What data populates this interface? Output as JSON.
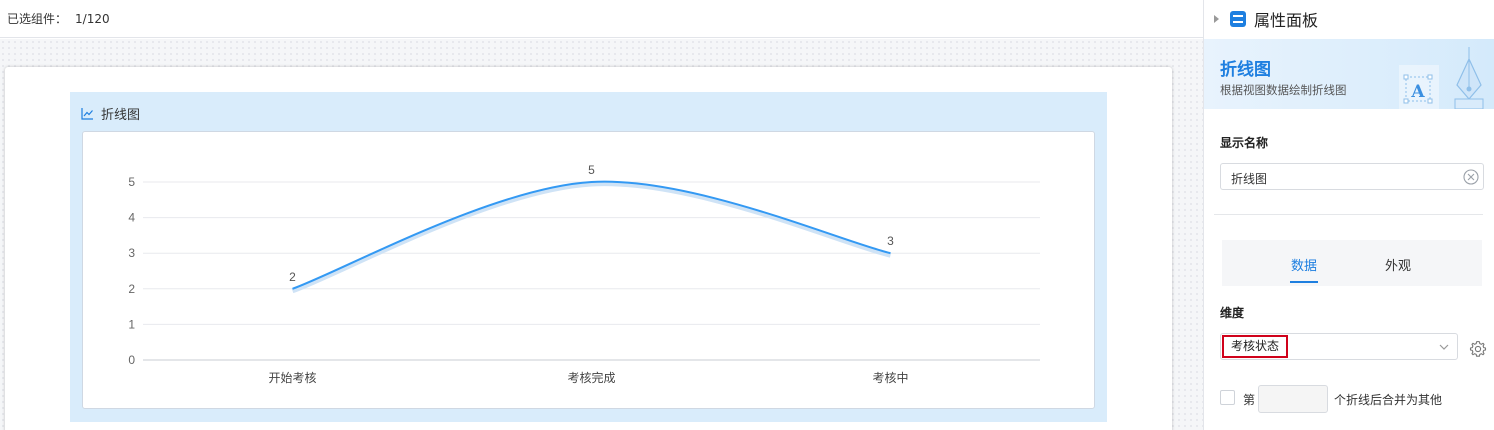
{
  "canvas": {
    "selected_label": "已选组件：",
    "selected_value": "1/120"
  },
  "widget": {
    "title": "折线图",
    "icon": "line-chart-icon"
  },
  "chart_data": {
    "type": "line",
    "categories": [
      "开始考核",
      "考核完成",
      "考核中"
    ],
    "values": [
      2,
      5,
      3
    ],
    "data_labels": [
      "2",
      "5",
      "3"
    ],
    "ylim": [
      0,
      5
    ],
    "y_ticks": [
      "0",
      "1",
      "2",
      "3",
      "4",
      "5"
    ],
    "smooth": true,
    "grid": true,
    "line_color": "#3399f3"
  },
  "panel": {
    "title": "属性面板",
    "banner_title": "折线图",
    "banner_desc": "根据视图数据绘制折线图",
    "display_name_label": "显示名称",
    "display_name_value": "折线图",
    "tabs": [
      {
        "label": "数据",
        "active": true
      },
      {
        "label": "外观",
        "active": false
      }
    ],
    "dimension_label": "维度",
    "dimension_value": "考核状态",
    "merge_prefix": "第",
    "merge_suffix": "个折线后合并为其他",
    "merge_count": ""
  },
  "colors": {
    "accent": "#1e7fe0",
    "highlight_border": "#d0021b"
  }
}
